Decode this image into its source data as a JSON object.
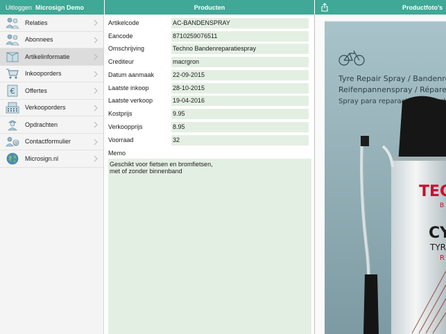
{
  "header": {
    "logout_label": "Uitloggen",
    "app_title": "Microsign Demo",
    "center_title": "Producten",
    "right_title": "Productfoto's"
  },
  "colors": {
    "accent": "#3fa896",
    "field_bg": "#e4efe3",
    "selected_bg": "#dcdcdc"
  },
  "sidebar": {
    "items": [
      {
        "label": "Relaties",
        "icon": "people-icon"
      },
      {
        "label": "Abonnees",
        "icon": "people-icon"
      },
      {
        "label": "Artikelinformatie",
        "icon": "box-icon"
      },
      {
        "label": "Inkooporders",
        "icon": "cart-icon"
      },
      {
        "label": "Offertes",
        "icon": "euro-icon"
      },
      {
        "label": "Verkooporders",
        "icon": "register-icon"
      },
      {
        "label": "Opdrachten",
        "icon": "worker-icon"
      },
      {
        "label": "Contactformulier",
        "icon": "contact-icon"
      },
      {
        "label": "Microsign.nl",
        "icon": "globe-icon"
      }
    ]
  },
  "product": {
    "fields": [
      {
        "label": "Artikelcode",
        "value": "AC-BANDENSPRAY"
      },
      {
        "label": "Eancode",
        "value": "8710259076511"
      },
      {
        "label": "Omschrijving",
        "value": "Techno Bandenreparatiespray"
      },
      {
        "label": "Crediteur",
        "value": "macrgron"
      },
      {
        "label": "Datum aanmaak",
        "value": "22-09-2015"
      },
      {
        "label": "Laatste inkoop",
        "value": "28-10-2015"
      },
      {
        "label": "Laatste verkoop",
        "value": "19-04-2016"
      },
      {
        "label": "Kostprijs",
        "value": "9.95"
      },
      {
        "label": "Verkoopprijs",
        "value": "8.95"
      },
      {
        "label": "Voorraad",
        "value": "32"
      }
    ],
    "memo_label": "Memo",
    "memo_text": "Geschikt voor fietsen en bromfietsen,\nmet of zonder binnenband"
  },
  "photo": {
    "package_lines": [
      "Tyre Repair Spray / Bandenrepar",
      "Reifenpannenspray / Répare et",
      "Spray para reparación de pinchazo"
    ],
    "can_brand": "TEC",
    "can_sub": "B",
    "can_cy": "CY",
    "can_tyr": "TYR",
    "can_r": "R"
  }
}
